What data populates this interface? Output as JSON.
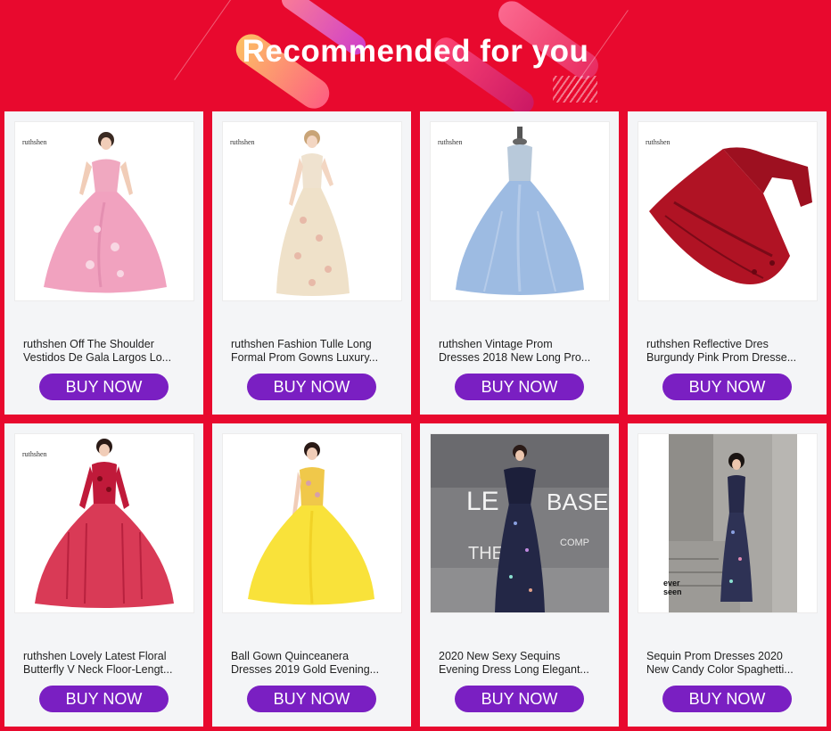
{
  "header": {
    "title": "Recommended for you"
  },
  "colors": {
    "background": "#e8092e",
    "button": "#7a1fc2",
    "card": "#f4f5f7"
  },
  "products": [
    {
      "brand": "ruthshen",
      "line1": "ruthshen Off The Shoulder",
      "line2": "Vestidos De Gala Largos Lo...",
      "button": "BUY NOW"
    },
    {
      "brand": "ruthshen",
      "line1": "ruthshen Fashion Tulle Long",
      "line2": "Formal Prom Gowns Luxury...",
      "button": "BUY NOW"
    },
    {
      "brand": "ruthshen",
      "line1": "ruthshen Vintage Prom",
      "line2": "Dresses 2018 New Long Pro...",
      "button": "BUY NOW"
    },
    {
      "brand": "ruthshen",
      "line1": "ruthshen Reflective Dres",
      "line2": "Burgundy Pink Prom Dresse...",
      "button": "BUY NOW"
    },
    {
      "brand": "ruthshen",
      "line1": "ruthshen Lovely Latest Floral",
      "line2": "Butterfly V Neck Floor-Lengt...",
      "button": "BUY NOW"
    },
    {
      "brand": "",
      "line1": "Ball Gown Quinceanera",
      "line2": "Dresses 2019 Gold Evening...",
      "button": "BUY NOW"
    },
    {
      "brand": "",
      "line1": "2020 New Sexy Sequins",
      "line2": "Evening Dress Long Elegant...",
      "button": "BUY NOW",
      "photo_text": [
        "LE",
        "BASES",
        "THE",
        "COMP"
      ]
    },
    {
      "brand": "",
      "line1": "Sequin Prom Dresses 2020",
      "line2": "New Candy Color Spaghetti...",
      "button": "BUY NOW",
      "photo_text": [
        "ever",
        "seen"
      ]
    }
  ]
}
